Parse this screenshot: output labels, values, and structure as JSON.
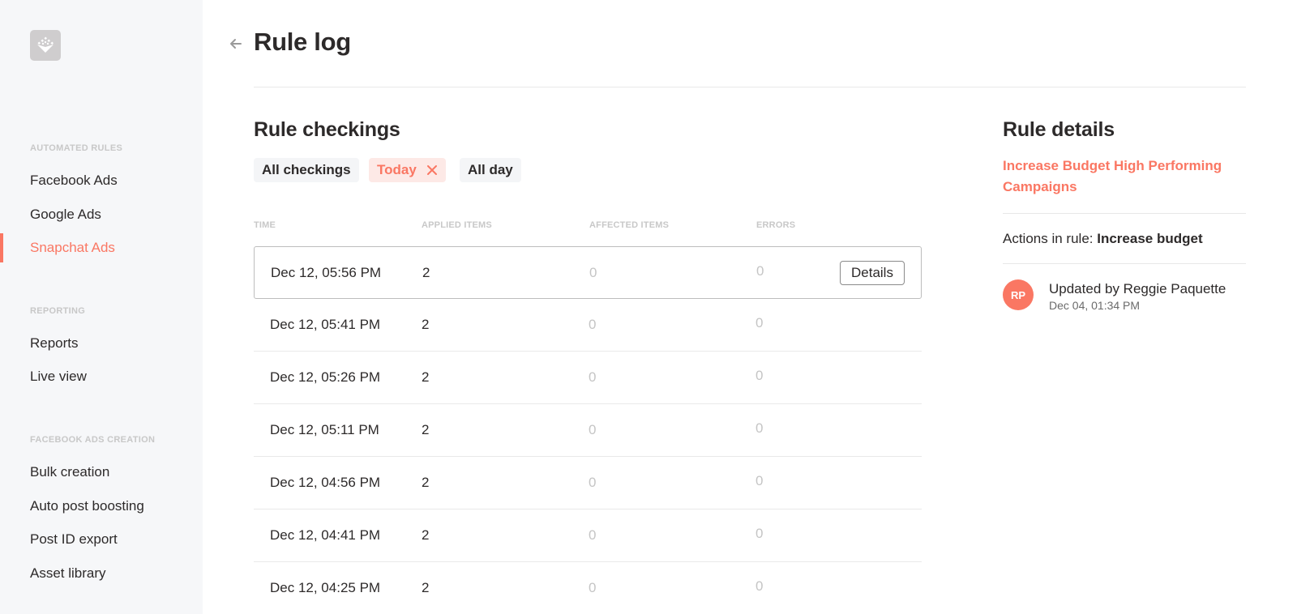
{
  "app": {
    "logo_icon": "brand-logo-icon"
  },
  "sidebar": {
    "sections": [
      {
        "label": "AUTOMATED RULES",
        "items": [
          {
            "label": "Facebook Ads",
            "active": false
          },
          {
            "label": "Google Ads",
            "active": false
          },
          {
            "label": "Snapchat Ads",
            "active": true
          }
        ]
      },
      {
        "label": "REPORTING",
        "items": [
          {
            "label": "Reports",
            "active": false
          },
          {
            "label": "Live view",
            "active": false
          }
        ]
      },
      {
        "label": "FACEBOOK ADS CREATION",
        "items": [
          {
            "label": "Bulk creation",
            "active": false
          },
          {
            "label": "Auto post boosting",
            "active": false
          },
          {
            "label": "Post ID export",
            "active": false
          },
          {
            "label": "Asset library",
            "active": false
          }
        ]
      }
    ]
  },
  "header": {
    "back_icon": "arrow-left-icon",
    "title": "Rule log"
  },
  "checkings": {
    "title": "Rule checkings",
    "filters": [
      {
        "label": "All checkings",
        "selected": false
      },
      {
        "label": "Today",
        "selected": true,
        "removable": true
      },
      {
        "label": "All day",
        "selected": false
      }
    ],
    "columns": [
      "TIME",
      "APPLIED ITEMS",
      "AFFECTED ITEMS",
      "ERRORS"
    ],
    "rows": [
      {
        "time": "Dec 12, 05:56 PM",
        "applied": "2",
        "affected": "0",
        "errors": "0",
        "highlighted": true
      },
      {
        "time": "Dec 12, 05:41 PM",
        "applied": "2",
        "affected": "0",
        "errors": "0"
      },
      {
        "time": "Dec 12, 05:26 PM",
        "applied": "2",
        "affected": "0",
        "errors": "0"
      },
      {
        "time": "Dec 12, 05:11 PM",
        "applied": "2",
        "affected": "0",
        "errors": "0"
      },
      {
        "time": "Dec 12, 04:56 PM",
        "applied": "2",
        "affected": "0",
        "errors": "0"
      },
      {
        "time": "Dec 12, 04:41 PM",
        "applied": "2",
        "affected": "0",
        "errors": "0"
      },
      {
        "time": "Dec 12, 04:25 PM",
        "applied": "2",
        "affected": "0",
        "errors": "0"
      }
    ],
    "details_button_label": "Details"
  },
  "rule_details": {
    "title": "Rule details",
    "rule_name": "Increase Budget High Performing Campaigns",
    "actions_label": "Actions in rule:",
    "actions_value": "Increase budget",
    "updated_by": "Updated by Reggie Paquette",
    "updated_at": "Dec 04, 01:34 PM",
    "avatar_initials": "RP"
  },
  "colors": {
    "accent": "#fa7763",
    "sidebar_bg": "#f6f7f9",
    "text": "#2d2a2a",
    "muted": "#c5c5c5"
  }
}
